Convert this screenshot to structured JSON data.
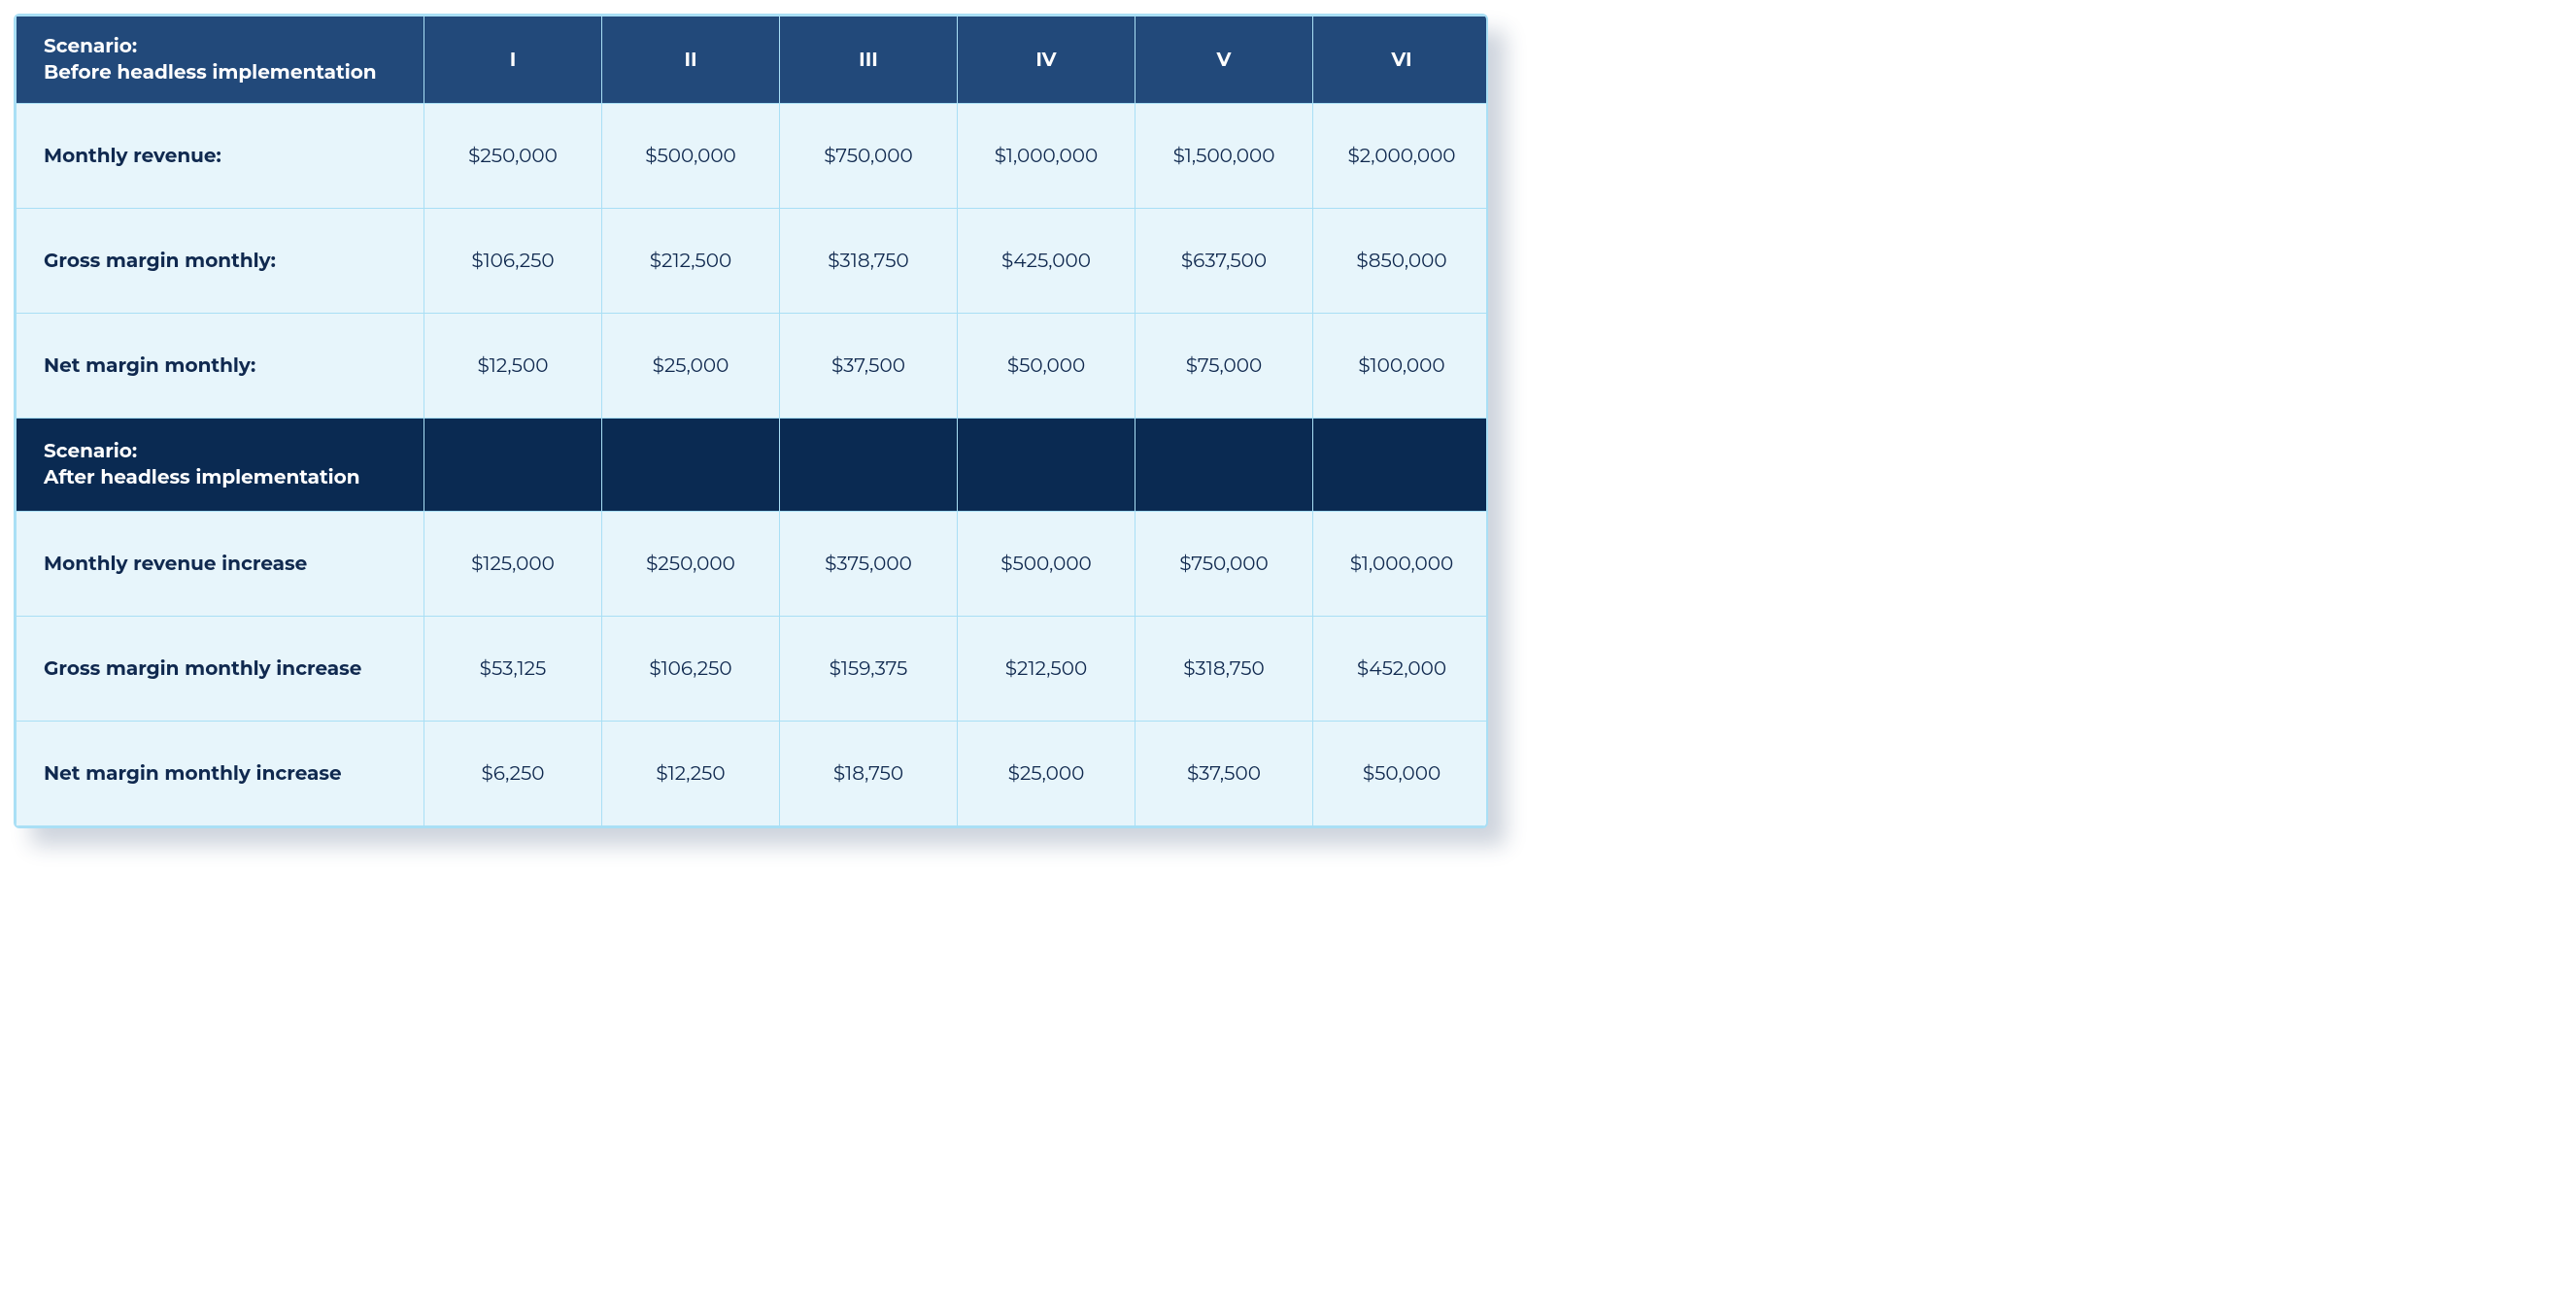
{
  "chart_data": {
    "type": "table",
    "title": "",
    "section1": {
      "heading_line1": "Scenario:",
      "heading_line2": "Before headless implementation",
      "columns": [
        "I",
        "II",
        "III",
        "IV",
        "V",
        "VI"
      ],
      "rows": [
        {
          "label": "Monthly revenue:",
          "values": [
            "$250,000",
            "$500,000",
            "$750,000",
            "$1,000,000",
            "$1,500,000",
            "$2,000,000"
          ]
        },
        {
          "label": "Gross margin monthly:",
          "values": [
            "$106,250",
            "$212,500",
            "$318,750",
            "$425,000",
            "$637,500",
            "$850,000"
          ]
        },
        {
          "label": "Net margin monthly:",
          "values": [
            "$12,500",
            "$25,000",
            "$37,500",
            "$50,000",
            "$75,000",
            "$100,000"
          ]
        }
      ]
    },
    "section2": {
      "heading_line1": "Scenario:",
      "heading_line2": "After headless implementation",
      "rows": [
        {
          "label": "Monthly revenue increase",
          "values": [
            "$125,000",
            "$250,000",
            "$375,000",
            "$500,000",
            "$750,000",
            "$1,000,000"
          ]
        },
        {
          "label": "Gross margin monthly increase",
          "values": [
            "$53,125",
            "$106,250",
            "$159,375",
            "$212,500",
            "$318,750",
            "$452,000"
          ]
        },
        {
          "label": "Net margin monthly increase",
          "values": [
            "$6,250",
            "$12,250",
            "$18,750",
            "$25,000",
            "$37,500",
            "$50,000"
          ]
        }
      ]
    }
  }
}
